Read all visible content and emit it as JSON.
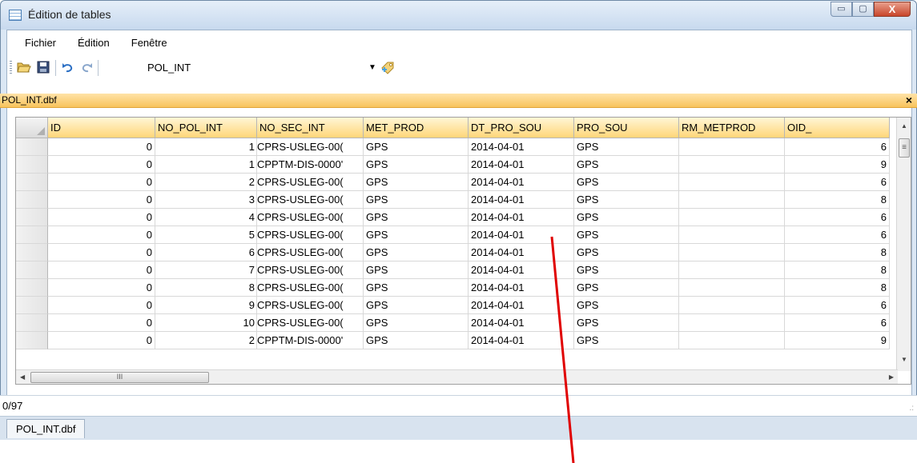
{
  "window": {
    "title": "Édition de tables",
    "controls": {
      "minimize": "▭",
      "maximize": "▢",
      "close": "X"
    }
  },
  "menu": [
    "Fichier",
    "Édition",
    "Fenêtre"
  ],
  "toolbar": {
    "open_icon": "folder-open-icon",
    "save_icon": "save-icon",
    "undo_icon": "undo-icon",
    "redo_icon": "redo-icon",
    "table_value": "POL_INT",
    "add_icon": "add-table-icon"
  },
  "panel": {
    "title": "POL_INT.dbf",
    "close": "×"
  },
  "table": {
    "columns": [
      "ID",
      "NO_POL_INT",
      "NO_SEC_INT",
      "MET_PROD",
      "DT_PRO_SOU",
      "PRO_SOU",
      "RM_METPROD",
      "OID_"
    ],
    "rows": [
      [
        "0",
        "1",
        "CPRS-USLEG-00(",
        "GPS",
        "2014-04-01",
        "GPS",
        "",
        "6"
      ],
      [
        "0",
        "1",
        "CPPTM-DIS-0000'",
        "GPS",
        "2014-04-01",
        "GPS",
        "",
        "9"
      ],
      [
        "0",
        "2",
        "CPRS-USLEG-00(",
        "GPS",
        "2014-04-01",
        "GPS",
        "",
        "6"
      ],
      [
        "0",
        "3",
        "CPRS-USLEG-00(",
        "GPS",
        "2014-04-01",
        "GPS",
        "",
        "8"
      ],
      [
        "0",
        "4",
        "CPRS-USLEG-00(",
        "GPS",
        "2014-04-01",
        "GPS",
        "",
        "6"
      ],
      [
        "0",
        "5",
        "CPRS-USLEG-00(",
        "GPS",
        "2014-04-01",
        "GPS",
        "",
        "6"
      ],
      [
        "0",
        "6",
        "CPRS-USLEG-00(",
        "GPS",
        "2014-04-01",
        "GPS",
        "",
        "8"
      ],
      [
        "0",
        "7",
        "CPRS-USLEG-00(",
        "GPS",
        "2014-04-01",
        "GPS",
        "",
        "8"
      ],
      [
        "0",
        "8",
        "CPRS-USLEG-00(",
        "GPS",
        "2014-04-01",
        "GPS",
        "",
        "8"
      ],
      [
        "0",
        "9",
        "CPRS-USLEG-00(",
        "GPS",
        "2014-04-01",
        "GPS",
        "",
        "6"
      ],
      [
        "0",
        "10",
        "CPRS-USLEG-00(",
        "GPS",
        "2014-04-01",
        "GPS",
        "",
        "6"
      ],
      [
        "0",
        "2",
        "CPPTM-DIS-0000'",
        "GPS",
        "2014-04-01",
        "GPS",
        "",
        "9"
      ]
    ]
  },
  "status": {
    "record_count": "0/97"
  },
  "doc_tab": "POL_INT.dbf",
  "colors": {
    "header_accent": "#f8c35c",
    "annotation": "#e00000"
  }
}
